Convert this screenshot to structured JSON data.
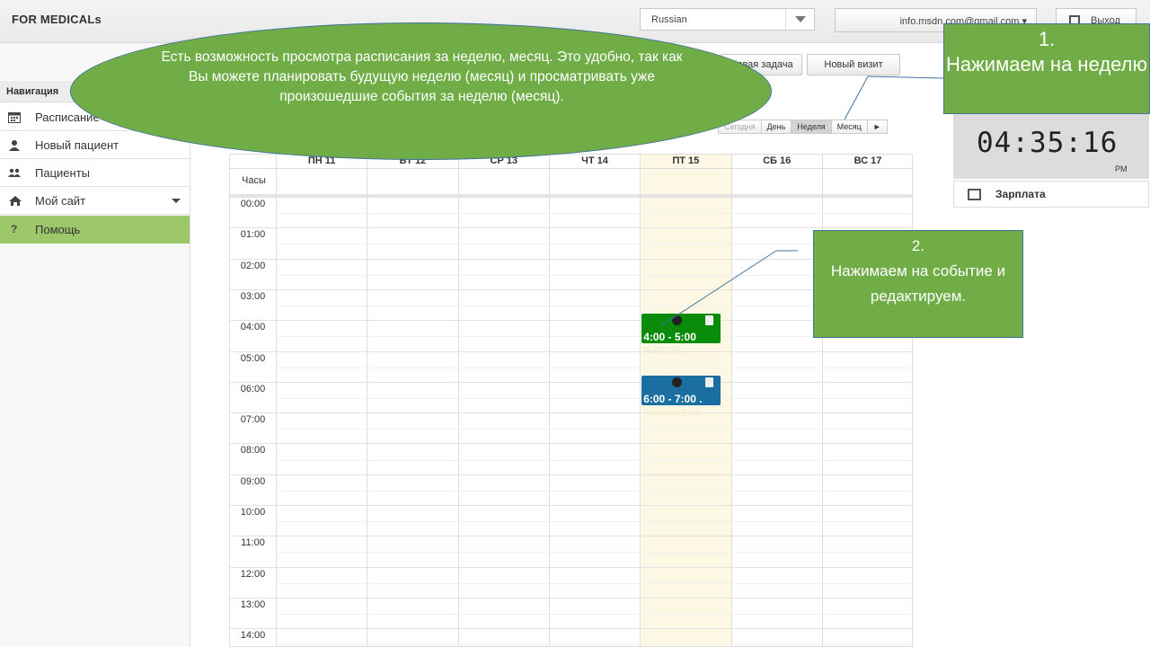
{
  "header": {
    "brand": "FOR MEDICALs",
    "language": "Russian",
    "user_email": "info.msdn.com@gmail.com ▾",
    "logout": "Выход"
  },
  "sidebar": {
    "heading": "Навигация",
    "items": [
      {
        "label": "Расписание",
        "icon": "calendar-icon"
      },
      {
        "label": "Новый пациент",
        "icon": "user-icon"
      },
      {
        "label": "Пациенты",
        "icon": "users-icon"
      },
      {
        "label": "Мой сайт",
        "icon": "home-icon"
      },
      {
        "label": "Помощь",
        "icon": "question-icon"
      }
    ]
  },
  "toolbar": {
    "new_task": "Новая задача",
    "new_visit": "Новый визит"
  },
  "calendar_nav": {
    "today": "Сегодня",
    "day": "День",
    "week": "Неделя",
    "month": "Месяц",
    "next": "►"
  },
  "calendar": {
    "hours_label": "Часы",
    "days": [
      "ПН 11",
      "ВТ 12",
      "СР 13",
      "ЧТ 14",
      "ПТ 15",
      "СБ 16",
      "ВС 17"
    ],
    "hours": [
      "00:00",
      "01:00",
      "02:00",
      "03:00",
      "04:00",
      "05:00",
      "06:00",
      "07:00",
      "08:00",
      "09:00",
      "10:00",
      "11:00",
      "12:00",
      "13:00",
      "14:00"
    ],
    "events": [
      {
        "time": "4:00 - 5:00",
        "title": "R 53236 ,",
        "color": "#0a8c0a"
      },
      {
        "time": "6:00 - 7:00 .",
        "title": "Theme: Buy",
        "color": "#1a6fa0"
      }
    ],
    "today_highlight": "#fcf8e3"
  },
  "clock": {
    "time": "04:35:16",
    "ampm": "PM"
  },
  "right_panel": {
    "salary": "Зарплата"
  },
  "annotations": {
    "ellipse_text": "Есть возможность просмотра  расписания за неделю, месяц. Это удобно, так как Вы можете планировать будущую неделю (месяц) и просматривать уже произошедшие  события за неделю (месяц).",
    "note1_num": "1.",
    "note1_text": "Нажимаем на неделю",
    "note2_num": "2.",
    "note2_text": "Нажимаем на событие и редактируем."
  }
}
